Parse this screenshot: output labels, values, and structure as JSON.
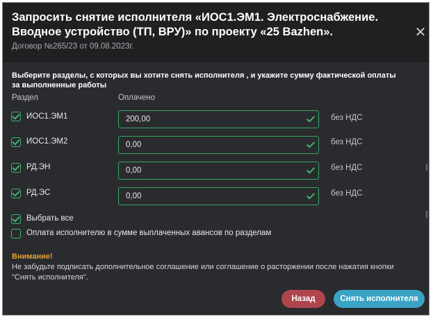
{
  "dialog": {
    "title": "Запросить снятие исполнителя «ИОС1.ЭМ1. Электроснабжение. Вводное устройство (ТП, ВРУ)» по проекту «25 Bazhen».",
    "subtitle": "Договор №265/23 от 09.08.2023г.",
    "close_symbol": "✕",
    "instruction": "Выберите разделы, с которых вы хотите снять исполнителя , и укажите сумму фактической оплаты за выполненные работы",
    "columns": {
      "section": "Раздел",
      "paid": "Оплачено"
    },
    "rows": [
      {
        "label": "ИОС1.ЭМ1",
        "value": "200,00",
        "vat": "без НДС",
        "checked": true
      },
      {
        "label": "ИОС1.ЭМ2",
        "value": "0,00",
        "vat": "без НДС",
        "checked": true
      },
      {
        "label": "РД.ЭН",
        "value": "0,00",
        "vat": "без НДС",
        "checked": true
      },
      {
        "label": "РД.ЭС",
        "value": "0,00",
        "vat": "без НДС",
        "checked": true
      }
    ],
    "select_all": {
      "label": "Выбрать все",
      "checked": true
    },
    "advance_option": {
      "label": "Оплата исполнителю в сумме выплаченных авансов по разделам",
      "checked": false
    },
    "warning": {
      "title": "Внимание!",
      "text": "Не забудьте подписать дополнительное соглашение или соглашение о расторжении после нажатия кнопки \"Снять исполнителя\"."
    },
    "buttons": {
      "back": "Назад",
      "remove": "Снять исполнителя"
    },
    "colors": {
      "accent_green": "#3fb56f",
      "back_button": "#b0454e",
      "primary_button": "#3aa3c6",
      "warning": "#e6a032"
    }
  }
}
